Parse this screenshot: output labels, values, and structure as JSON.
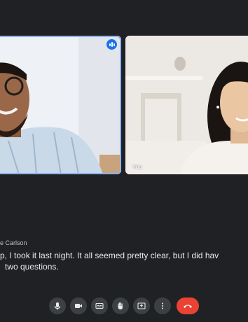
{
  "participants": [
    {
      "name": ""
    },
    {
      "name": "You"
    }
  ],
  "caption": {
    "speaker": "e Carlson",
    "lines": [
      "p, I took it last night. It all seemed pretty clear, but I did hav",
      "two questions."
    ]
  },
  "controls": [
    {
      "icon": "microphone-icon"
    },
    {
      "icon": "camera-icon"
    },
    {
      "icon": "closed-captions-icon"
    },
    {
      "icon": "raise-hand-icon"
    },
    {
      "icon": "present-screen-icon"
    },
    {
      "icon": "more-options-icon"
    },
    {
      "icon": "end-call-icon"
    }
  ],
  "colors": {
    "background": "#202124",
    "active_speaker_border": "#8ab4f8",
    "control_button": "#3c4043",
    "end_call": "#ea4335",
    "speaking_indicator": "#1a73e8"
  }
}
